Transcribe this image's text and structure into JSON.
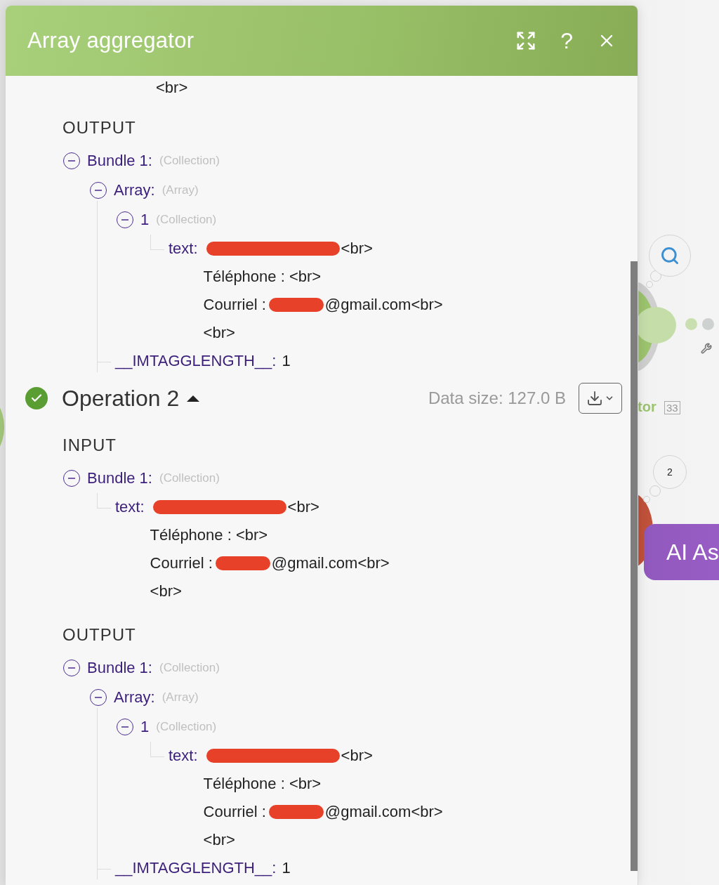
{
  "panel": {
    "title": "Array aggregator",
    "help_label": "?"
  },
  "top_fragment": "<br>",
  "sections": [
    {
      "kind": "section",
      "label": "OUTPUT",
      "tree": [
        {
          "name": "Bundle 1:",
          "type": "(Collection)",
          "expanded": true,
          "children": [
            {
              "name": "Array:",
              "type": "(Array)",
              "expanded": true,
              "children": [
                {
                  "name": "1",
                  "type": "(Collection)",
                  "expanded": true,
                  "children": [
                    {
                      "name": "text:",
                      "lines": [
                        {
                          "redacted": true,
                          "suffix": "<br>"
                        },
                        {
                          "suffix": "Téléphone : <br>"
                        },
                        {
                          "prefix": "Courriel :",
                          "redacted": true,
                          "suffix": "@gmail.com<br>"
                        },
                        {
                          "suffix": "<br>"
                        }
                      ]
                    }
                  ]
                }
              ]
            },
            {
              "name": "__IMTAGGLENGTH__:",
              "value": "1"
            }
          ]
        }
      ]
    },
    {
      "kind": "operation",
      "title": "Operation 2",
      "success": true,
      "expanded": true,
      "data_size": "Data size: 127.0 B"
    },
    {
      "kind": "section",
      "label": "INPUT",
      "tree": [
        {
          "name": "Bundle 1:",
          "type": "(Collection)",
          "expanded": true,
          "children": [
            {
              "name": "text:",
              "lines": [
                {
                  "redacted": true,
                  "suffix": "<br>"
                },
                {
                  "suffix": "Téléphone : <br>"
                },
                {
                  "prefix": "Courriel :",
                  "redacted": true,
                  "suffix": "@gmail.com<br>"
                },
                {
                  "suffix": "<br>"
                }
              ]
            }
          ]
        }
      ]
    },
    {
      "kind": "section",
      "label": "OUTPUT",
      "tree": [
        {
          "name": "Bundle 1:",
          "type": "(Collection)",
          "expanded": true,
          "children": [
            {
              "name": "Array:",
              "type": "(Array)",
              "expanded": true,
              "children": [
                {
                  "name": "1",
                  "type": "(Collection)",
                  "expanded": true,
                  "children": [
                    {
                      "name": "text:",
                      "lines": [
                        {
                          "redacted": true,
                          "suffix": "<br>"
                        },
                        {
                          "suffix": "Téléphone : <br>"
                        },
                        {
                          "prefix": "Courriel :",
                          "redacted": true,
                          "suffix": "@gmail.com<br>"
                        },
                        {
                          "suffix": "<br>"
                        }
                      ]
                    }
                  ]
                }
              ]
            },
            {
              "name": "__IMTAGGLENGTH__:",
              "value": "1"
            }
          ]
        }
      ]
    }
  ],
  "canvas": {
    "module_label": "tor",
    "module_count": "33",
    "route_badge": "2",
    "ai_button": "AI As"
  }
}
